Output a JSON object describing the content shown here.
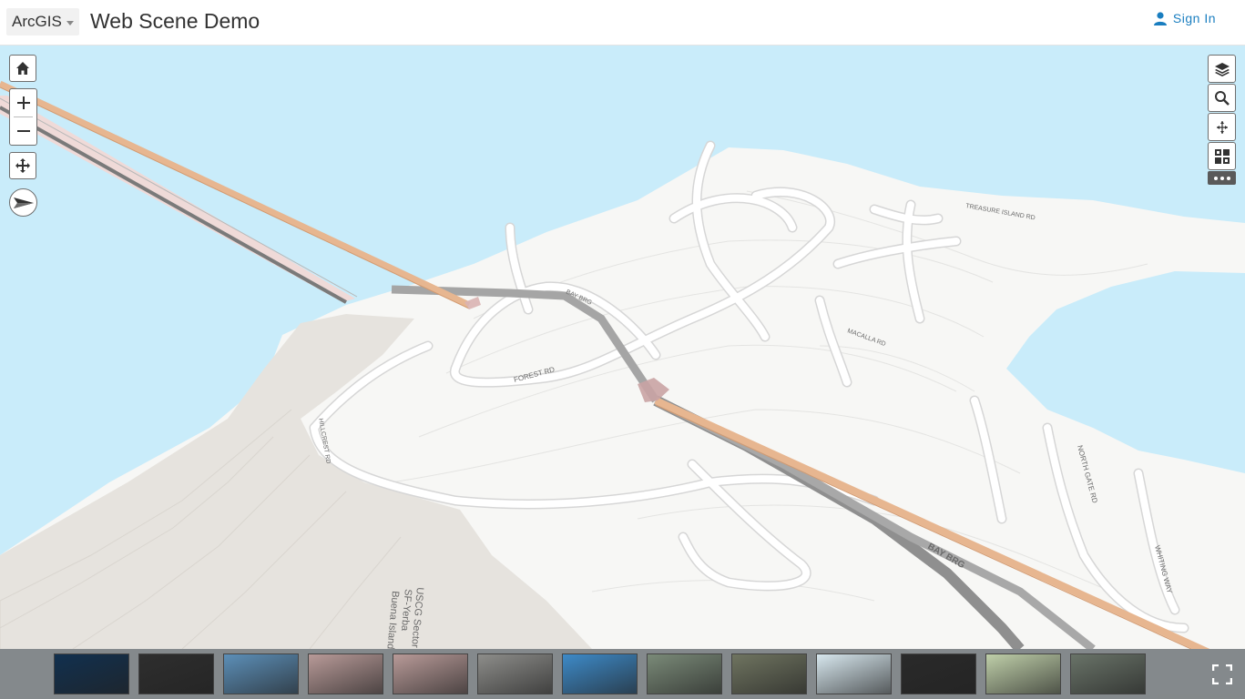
{
  "header": {
    "app_switcher_label": "ArcGIS",
    "title": "Web Scene Demo",
    "signin_label": "Sign In"
  },
  "map": {
    "road_labels": {
      "bay_brg_1": "BAY BRG",
      "bay_brg_2": "BAY BRG",
      "forest_rd": "FOREST RD",
      "uscg_1": "USCG Sector",
      "uscg_2": "SF-Yerba",
      "uscg_3": "Buena Island",
      "north_gate_rd": "NORTH GATE RD",
      "whiting_way": "WHITING WAY",
      "macalla_rd": "MACALLA RD",
      "hillcrest_rd": "HILLCREST RD",
      "treasure_island": "TREASURE ISLAND RD"
    },
    "colors": {
      "water": "#c9ecfa",
      "land": "#f7f7f5",
      "beige_land": "#e6e3de",
      "bridge_orange": "#e7b690",
      "road_gray": "#8a8a8a"
    }
  },
  "tools": {
    "home": "home-icon",
    "zoom_in": "plus-icon",
    "zoom_out": "minus-icon",
    "pan": "pan-icon",
    "compass": "compass-icon",
    "layers": "layers-icon",
    "search": "search-icon",
    "navigate": "navigate-icon",
    "basemap": "basemap-gallery-icon",
    "more": "more-icon",
    "fullscreen": "fullscreen-icon"
  },
  "slides": [
    {
      "name": "slide-1",
      "color": "#11304f"
    },
    {
      "name": "slide-2",
      "color": "#2e2e2e"
    },
    {
      "name": "slide-3",
      "color": "#5c8fb8"
    },
    {
      "name": "slide-4",
      "color": "#b89a98"
    },
    {
      "name": "slide-5",
      "color": "#b89a98"
    },
    {
      "name": "slide-6",
      "color": "#8d8d8a"
    },
    {
      "name": "slide-7",
      "color": "#3d8ac8"
    },
    {
      "name": "slide-8",
      "color": "#7a8a78"
    },
    {
      "name": "slide-9",
      "color": "#6f7460"
    },
    {
      "name": "slide-10",
      "color": "#d7e7ee"
    },
    {
      "name": "slide-11",
      "color": "#2a2a2a"
    },
    {
      "name": "slide-12",
      "color": "#bfcfa9"
    },
    {
      "name": "slide-13",
      "color": "#697368"
    }
  ]
}
